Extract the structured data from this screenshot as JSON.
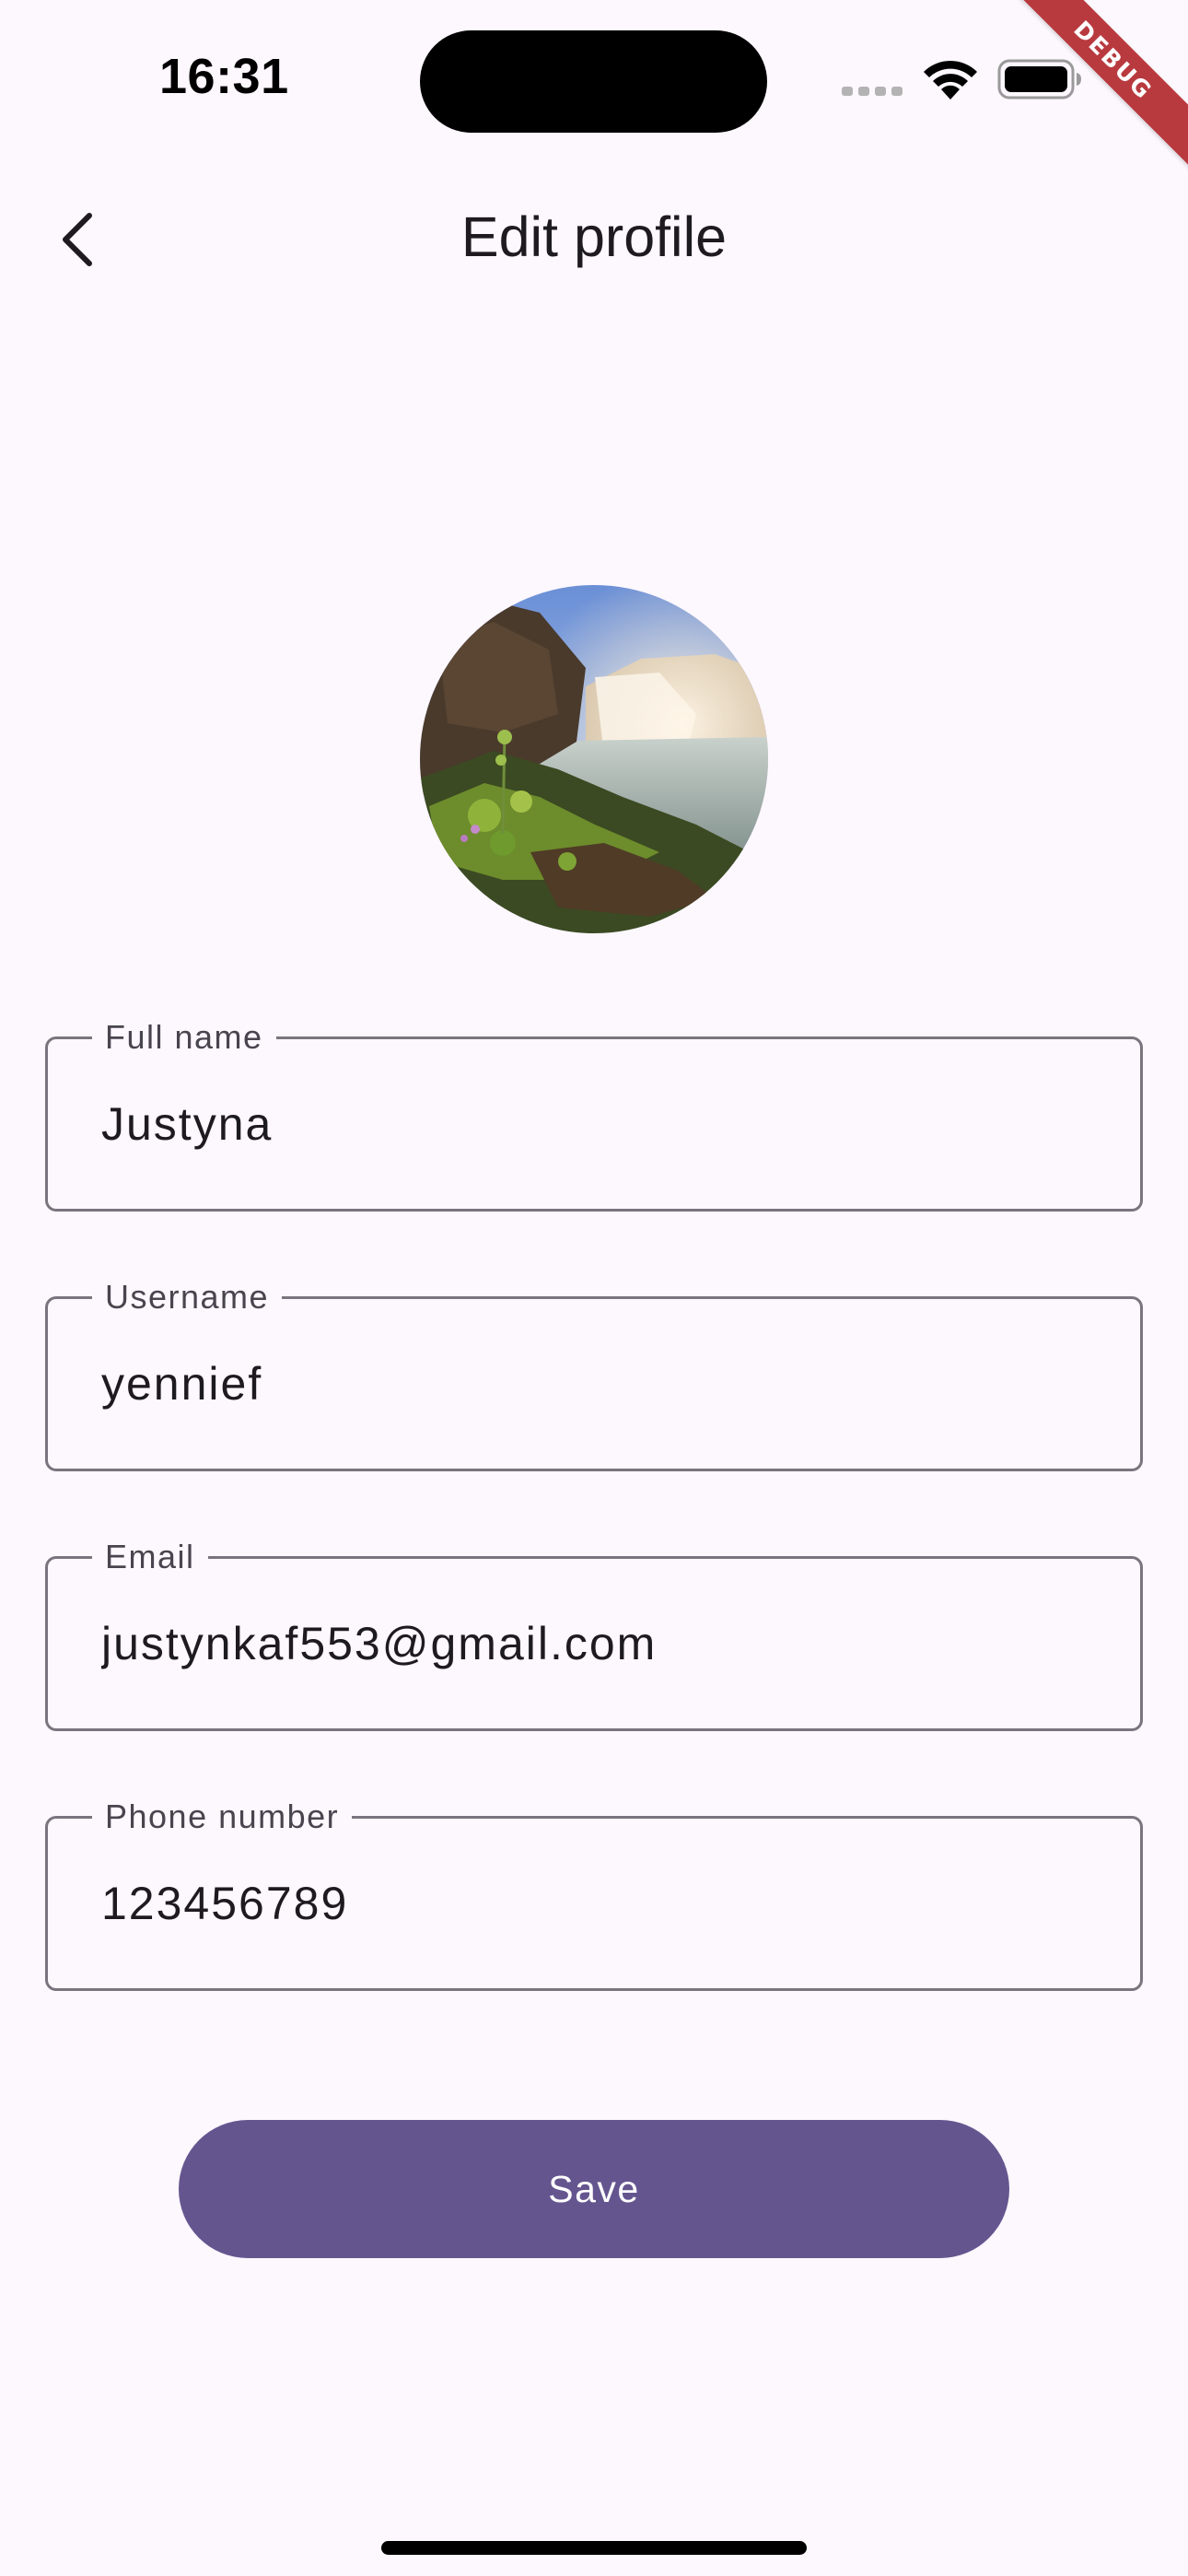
{
  "status_bar": {
    "time": "16:31",
    "wifi_icon": "wifi-icon",
    "battery_icon": "battery-icon"
  },
  "debug_banner": "DEBUG",
  "app_bar": {
    "back_icon": "chevron-left-icon",
    "title": "Edit profile"
  },
  "avatar": {
    "icon": "profile-photo-waterfall"
  },
  "form": {
    "full_name": {
      "label": "Full name",
      "value": "Justyna"
    },
    "username": {
      "label": "Username",
      "value": "yennief"
    },
    "email": {
      "label": "Email",
      "value": "justynkaf553@gmail.com"
    },
    "phone": {
      "label": "Phone number",
      "value": "123456789"
    }
  },
  "save_button": {
    "label": "Save"
  },
  "colors": {
    "background": "#fdf7fe",
    "primary": "#65558f",
    "outline": "#79747e",
    "debug_ribbon": "#b83a3f"
  }
}
